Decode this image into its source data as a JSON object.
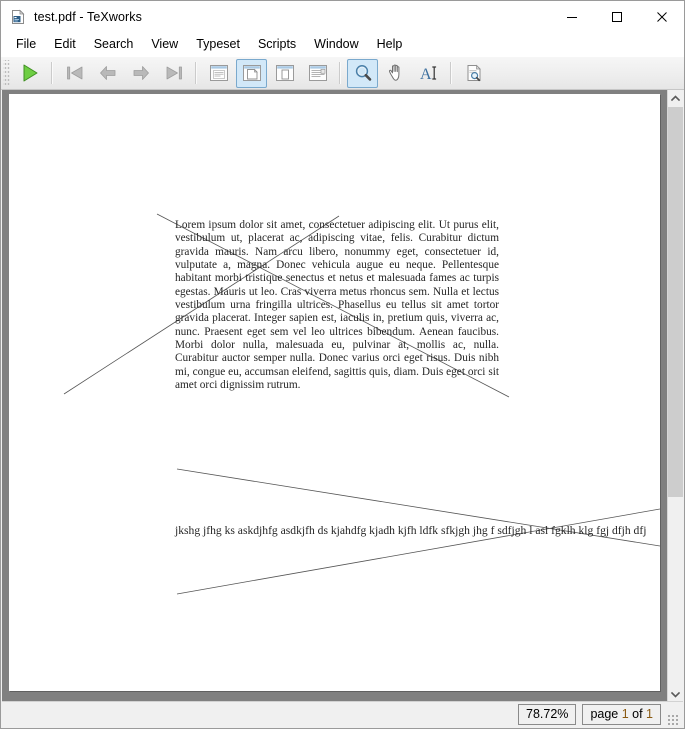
{
  "window": {
    "title": "test.pdf - TeXworks",
    "icon": "pdf-document-icon",
    "controls": {
      "minimize": "minimize-icon",
      "maximize": "maximize-icon",
      "close": "close-icon"
    }
  },
  "menubar": {
    "items": [
      {
        "label": "File"
      },
      {
        "label": "Edit"
      },
      {
        "label": "Search"
      },
      {
        "label": "View"
      },
      {
        "label": "Typeset"
      },
      {
        "label": "Scripts"
      },
      {
        "label": "Window"
      },
      {
        "label": "Help"
      }
    ]
  },
  "toolbar": {
    "buttons": [
      {
        "name": "typeset-button",
        "icon": "green-play-triangle-icon",
        "checked": false
      },
      {
        "name": "first-page-button",
        "icon": "jump-first-icon",
        "checked": false
      },
      {
        "name": "previous-page-button",
        "icon": "arrow-left-icon",
        "checked": false
      },
      {
        "name": "next-page-button",
        "icon": "arrow-right-icon",
        "checked": false
      },
      {
        "name": "last-page-button",
        "icon": "jump-last-icon",
        "checked": false
      },
      {
        "name": "fit-width-button",
        "icon": "fit-width-icon",
        "checked": false
      },
      {
        "name": "fit-page-button",
        "icon": "fit-page-icon",
        "checked": true
      },
      {
        "name": "actual-size-button",
        "icon": "actual-size-icon",
        "checked": false
      },
      {
        "name": "fit-content-button",
        "icon": "fit-content-icon",
        "checked": false
      },
      {
        "name": "magnify-tool-button",
        "icon": "magnifier-icon",
        "checked": true
      },
      {
        "name": "pan-tool-button",
        "icon": "hand-icon",
        "checked": false
      },
      {
        "name": "text-select-tool-button",
        "icon": "text-select-icon",
        "checked": false
      },
      {
        "name": "source-preview-button",
        "icon": "document-search-icon",
        "checked": false
      }
    ]
  },
  "document": {
    "paragraph": "Lorem ipsum dolor sit amet, consectetuer adipiscing elit. Ut purus elit, vestibulum ut, placerat ac, adipiscing vitae, felis. Curabitur dictum gravida mauris. Nam arcu libero, nonummy eget, consectetuer id, vulputate a, magna. Donec vehicula augue eu neque. Pellentesque habitant morbi tristique senectus et netus et malesuada fames ac turpis egestas. Mauris ut leo. Cras viverra metus rhoncus sem. Nulla et lectus vestibulum urna fringilla ultrices. Phasellus eu tellus sit amet tortor gravida placerat. Integer sapien est, iaculis in, pretium quis, viverra ac, nunc. Praesent eget sem vel leo ultrices bibendum. Aenean faucibus. Morbi dolor nulla, malesuada eu, pulvinar at, mollis ac, nulla. Curabitur auctor semper nulla. Donec varius orci eget risus. Duis nibh mi, congue eu, accumsan eleifend, sagittis quis, diam. Duis eget orci sit amet orci dignissim rutrum.",
    "long_line": "jkshg jfhg ks askdjhfg asdkjfh ds kjahdfg kjadh kjfh ldfk sfkjgh jhg f sdfjgh l asl fgklh klg fgj dfjh dfj"
  },
  "statusbar": {
    "zoom": "78.72%",
    "page_prefix": "page ",
    "page_current": "1",
    "page_middle": " of ",
    "page_total": "1"
  },
  "colors": {
    "accent_checked_bg": "#d2e8f8",
    "accent_checked_border": "#7aa9cd",
    "viewport_bg": "#808080",
    "page_bg": "#ffffff",
    "status_page_num": "#8a5a12",
    "play_green": "#5dc63a"
  }
}
